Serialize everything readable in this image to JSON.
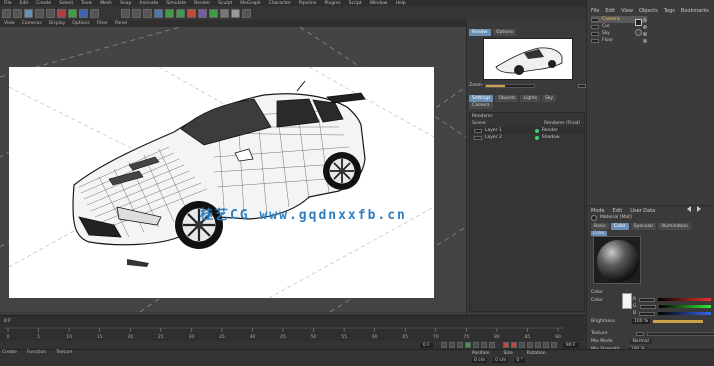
{
  "menubar": {
    "items": [
      "File",
      "Edit",
      "Create",
      "Select",
      "Tools",
      "Mesh",
      "Snap",
      "Animate",
      "Simulate",
      "Render",
      "Sculpt",
      "MoGraph",
      "Character",
      "Pipeline",
      "Plugins",
      "Script",
      "Window",
      "Help"
    ]
  },
  "viewport_menu": {
    "items": [
      "View",
      "Cameras",
      "Display",
      "Options",
      "Filter",
      "Panel"
    ]
  },
  "viewport": {
    "watermark": "桂艺CG www.gqdnxxfb.cn"
  },
  "object_manager": {
    "tabs": [
      "File",
      "Edit",
      "View",
      "Objects",
      "Tags",
      "Bookmarks"
    ],
    "objects": [
      {
        "name": "Camera",
        "selected": true
      },
      {
        "name": "Car",
        "selected": false
      },
      {
        "name": "Sky",
        "selected": false
      },
      {
        "name": "Floor",
        "selected": false
      }
    ]
  },
  "render_panel": {
    "tabs": [
      "Render",
      "Options"
    ],
    "zoom_label": "Zoom",
    "subtabs": [
      "Settings",
      "Objects",
      "Lights",
      "Sky",
      "Camera"
    ],
    "section": "Renderer",
    "row_header": "Scene",
    "header_value": "Renderer (Final)",
    "layers": [
      {
        "name": "Layer 1",
        "value": "Render"
      },
      {
        "name": "Layer 2",
        "value": "Shadow"
      }
    ]
  },
  "attributes": {
    "tabs": [
      "Mode",
      "Edit",
      "User Data"
    ],
    "material_title": "Material [Mat]",
    "mat_tabs": [
      "Basic",
      "Color",
      "Specular",
      "Illumination"
    ],
    "section": "Color",
    "color_label": "Color",
    "channels": [
      "R",
      "G",
      "B"
    ],
    "brightness_label": "Brightness",
    "brightness_value": "100 %",
    "texture_label": "Texture",
    "mix_mode_label": "Mix Mode",
    "mix_mode_value": "Normal",
    "mix_strength_label": "Mix Strength",
    "mix_strength_value": "100 %"
  },
  "timeline": {
    "current_frame": "0 F",
    "end_frame": "90 F",
    "ticks": [
      "0",
      "5",
      "10",
      "15",
      "20",
      "25",
      "30",
      "35",
      "40",
      "45",
      "50",
      "55",
      "60",
      "65",
      "70",
      "75",
      "80",
      "85",
      "90"
    ]
  },
  "bottom": {
    "tabs": [
      "Create",
      "Function",
      "Texture"
    ],
    "coords_header": [
      "Position",
      "Size",
      "Rotation"
    ],
    "coords_values": [
      "0 cm",
      "0 cm",
      "0 °"
    ]
  },
  "colors": {
    "accent": "#6a8fb5",
    "selected_green": "#3bd16f"
  }
}
